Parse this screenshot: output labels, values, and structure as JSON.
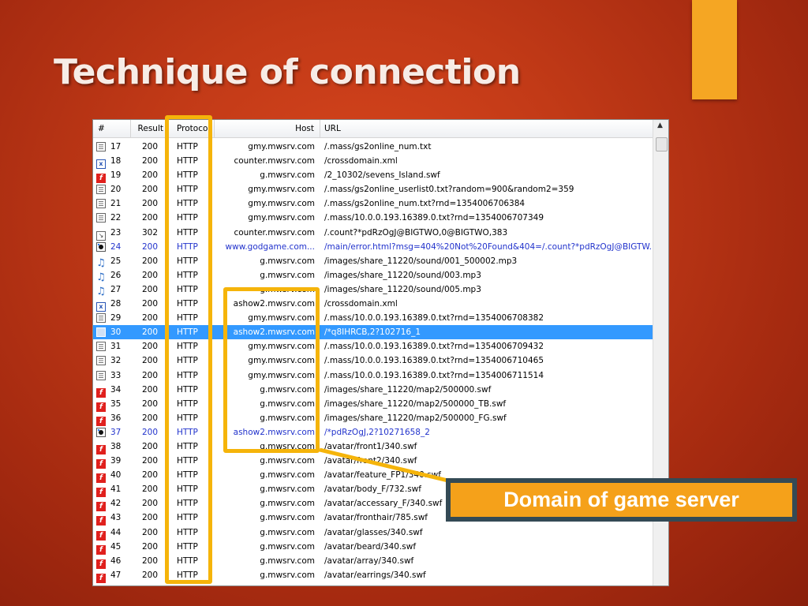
{
  "slide": {
    "title": "Technique of connection",
    "callout": "Domain of game server"
  },
  "table": {
    "columns": {
      "num": "#",
      "result": "Result",
      "protocol": "Protocol",
      "host": "Host",
      "url": "URL"
    },
    "selected_row": 13,
    "rows": [
      {
        "icon": "doc-icon",
        "num": "17",
        "result": "200",
        "protocol": "HTTP",
        "host": "gmy.mwsrv.com",
        "url": "/.mass/gs2online_num.txt"
      },
      {
        "icon": "xml-icon",
        "num": "18",
        "result": "200",
        "protocol": "HTTP",
        "host": "counter.mwsrv.com",
        "url": "/crossdomain.xml"
      },
      {
        "icon": "swf-icon",
        "num": "19",
        "result": "200",
        "protocol": "HTTP",
        "host": "g.mwsrv.com",
        "url": "/2_10302/sevens_Island.swf"
      },
      {
        "icon": "doc-icon",
        "num": "20",
        "result": "200",
        "protocol": "HTTP",
        "host": "gmy.mwsrv.com",
        "url": "/.mass/gs2online_userlist0.txt?random=900&random2=359"
      },
      {
        "icon": "doc-icon",
        "num": "21",
        "result": "200",
        "protocol": "HTTP",
        "host": "gmy.mwsrv.com",
        "url": "/.mass/gs2online_num.txt?rnd=1354006706384"
      },
      {
        "icon": "doc-icon",
        "num": "22",
        "result": "200",
        "protocol": "HTTP",
        "host": "gmy.mwsrv.com",
        "url": "/.mass/10.0.0.193.16389.0.txt?rnd=1354006707349"
      },
      {
        "icon": "redirect-icon",
        "num": "23",
        "result": "302",
        "protocol": "HTTP",
        "host": "counter.mwsrv.com",
        "url": "/.count?*pdRzOgJ@BIGTWO,0@BIGTWO,383"
      },
      {
        "icon": "error-icon",
        "num": "24",
        "result": "200",
        "protocol": "HTTP",
        "host": "www.godgame.com...",
        "url": "/main/error.html?msg=404%20Not%20Found&404=/.count?*pdRzOgJ@BIGTW.",
        "blue": true
      },
      {
        "icon": "audio-icon",
        "num": "25",
        "result": "200",
        "protocol": "HTTP",
        "host": "g.mwsrv.com",
        "url": "/images/share_11220/sound/001_500002.mp3"
      },
      {
        "icon": "audio-icon",
        "num": "26",
        "result": "200",
        "protocol": "HTTP",
        "host": "g.mwsrv.com",
        "url": "/images/share_11220/sound/003.mp3"
      },
      {
        "icon": "audio-icon",
        "num": "27",
        "result": "200",
        "protocol": "HTTP",
        "host": "g.mwsrv.com",
        "url": "/images/share_11220/sound/005.mp3"
      },
      {
        "icon": "xml-icon",
        "num": "28",
        "result": "200",
        "protocol": "HTTP",
        "host": "ashow2.mwsrv.com",
        "url": "/crossdomain.xml"
      },
      {
        "icon": "doc-icon",
        "num": "29",
        "result": "200",
        "protocol": "HTTP",
        "host": "gmy.mwsrv.com",
        "url": "/.mass/10.0.0.193.16389.0.txt?rnd=1354006708382"
      },
      {
        "icon": "selected-icon",
        "num": "30",
        "result": "200",
        "protocol": "HTTP",
        "host": "ashow2.mwsrv.com",
        "url": "/*q8IHRCB,2?102716_1"
      },
      {
        "icon": "doc-icon",
        "num": "31",
        "result": "200",
        "protocol": "HTTP",
        "host": "gmy.mwsrv.com",
        "url": "/.mass/10.0.0.193.16389.0.txt?rnd=1354006709432"
      },
      {
        "icon": "doc-icon",
        "num": "32",
        "result": "200",
        "protocol": "HTTP",
        "host": "gmy.mwsrv.com",
        "url": "/.mass/10.0.0.193.16389.0.txt?rnd=1354006710465"
      },
      {
        "icon": "doc-icon",
        "num": "33",
        "result": "200",
        "protocol": "HTTP",
        "host": "gmy.mwsrv.com",
        "url": "/.mass/10.0.0.193.16389.0.txt?rnd=1354006711514"
      },
      {
        "icon": "swf-icon",
        "num": "34",
        "result": "200",
        "protocol": "HTTP",
        "host": "g.mwsrv.com",
        "url": "/images/share_11220/map2/500000.swf"
      },
      {
        "icon": "swf-icon",
        "num": "35",
        "result": "200",
        "protocol": "HTTP",
        "host": "g.mwsrv.com",
        "url": "/images/share_11220/map2/500000_TB.swf"
      },
      {
        "icon": "swf-icon",
        "num": "36",
        "result": "200",
        "protocol": "HTTP",
        "host": "g.mwsrv.com",
        "url": "/images/share_11220/map2/500000_FG.swf"
      },
      {
        "icon": "error-icon",
        "num": "37",
        "result": "200",
        "protocol": "HTTP",
        "host": "ashow2.mwsrv.com",
        "url": "/*pdRzOgJ,2?10271658_2",
        "blue": true
      },
      {
        "icon": "swf-icon",
        "num": "38",
        "result": "200",
        "protocol": "HTTP",
        "host": "g.mwsrv.com",
        "url": "/avatar/front1/340.swf"
      },
      {
        "icon": "swf-icon",
        "num": "39",
        "result": "200",
        "protocol": "HTTP",
        "host": "g.mwsrv.com",
        "url": "/avatar/front2/340.swf"
      },
      {
        "icon": "swf-icon",
        "num": "40",
        "result": "200",
        "protocol": "HTTP",
        "host": "g.mwsrv.com",
        "url": "/avatar/feature_FP1/340.swf"
      },
      {
        "icon": "swf-icon",
        "num": "41",
        "result": "200",
        "protocol": "HTTP",
        "host": "g.mwsrv.com",
        "url": "/avatar/body_F/732.swf"
      },
      {
        "icon": "swf-icon",
        "num": "42",
        "result": "200",
        "protocol": "HTTP",
        "host": "g.mwsrv.com",
        "url": "/avatar/accessary_F/340.swf"
      },
      {
        "icon": "swf-icon",
        "num": "43",
        "result": "200",
        "protocol": "HTTP",
        "host": "g.mwsrv.com",
        "url": "/avatar/fronthair/785.swf"
      },
      {
        "icon": "swf-icon",
        "num": "44",
        "result": "200",
        "protocol": "HTTP",
        "host": "g.mwsrv.com",
        "url": "/avatar/glasses/340.swf"
      },
      {
        "icon": "swf-icon",
        "num": "45",
        "result": "200",
        "protocol": "HTTP",
        "host": "g.mwsrv.com",
        "url": "/avatar/beard/340.swf"
      },
      {
        "icon": "swf-icon",
        "num": "46",
        "result": "200",
        "protocol": "HTTP",
        "host": "g.mwsrv.com",
        "url": "/avatar/array/340.swf"
      },
      {
        "icon": "swf-icon",
        "num": "47",
        "result": "200",
        "protocol": "HTTP",
        "host": "g.mwsrv.com",
        "url": "/avatar/earrings/340.swf"
      }
    ]
  },
  "colors": {
    "background": "#c23a17",
    "accent": "#f5a623",
    "highlight_box": "#f5b40a",
    "callout_border": "#344a55",
    "selection": "#3399ff",
    "link_blue": "#2233cc"
  }
}
